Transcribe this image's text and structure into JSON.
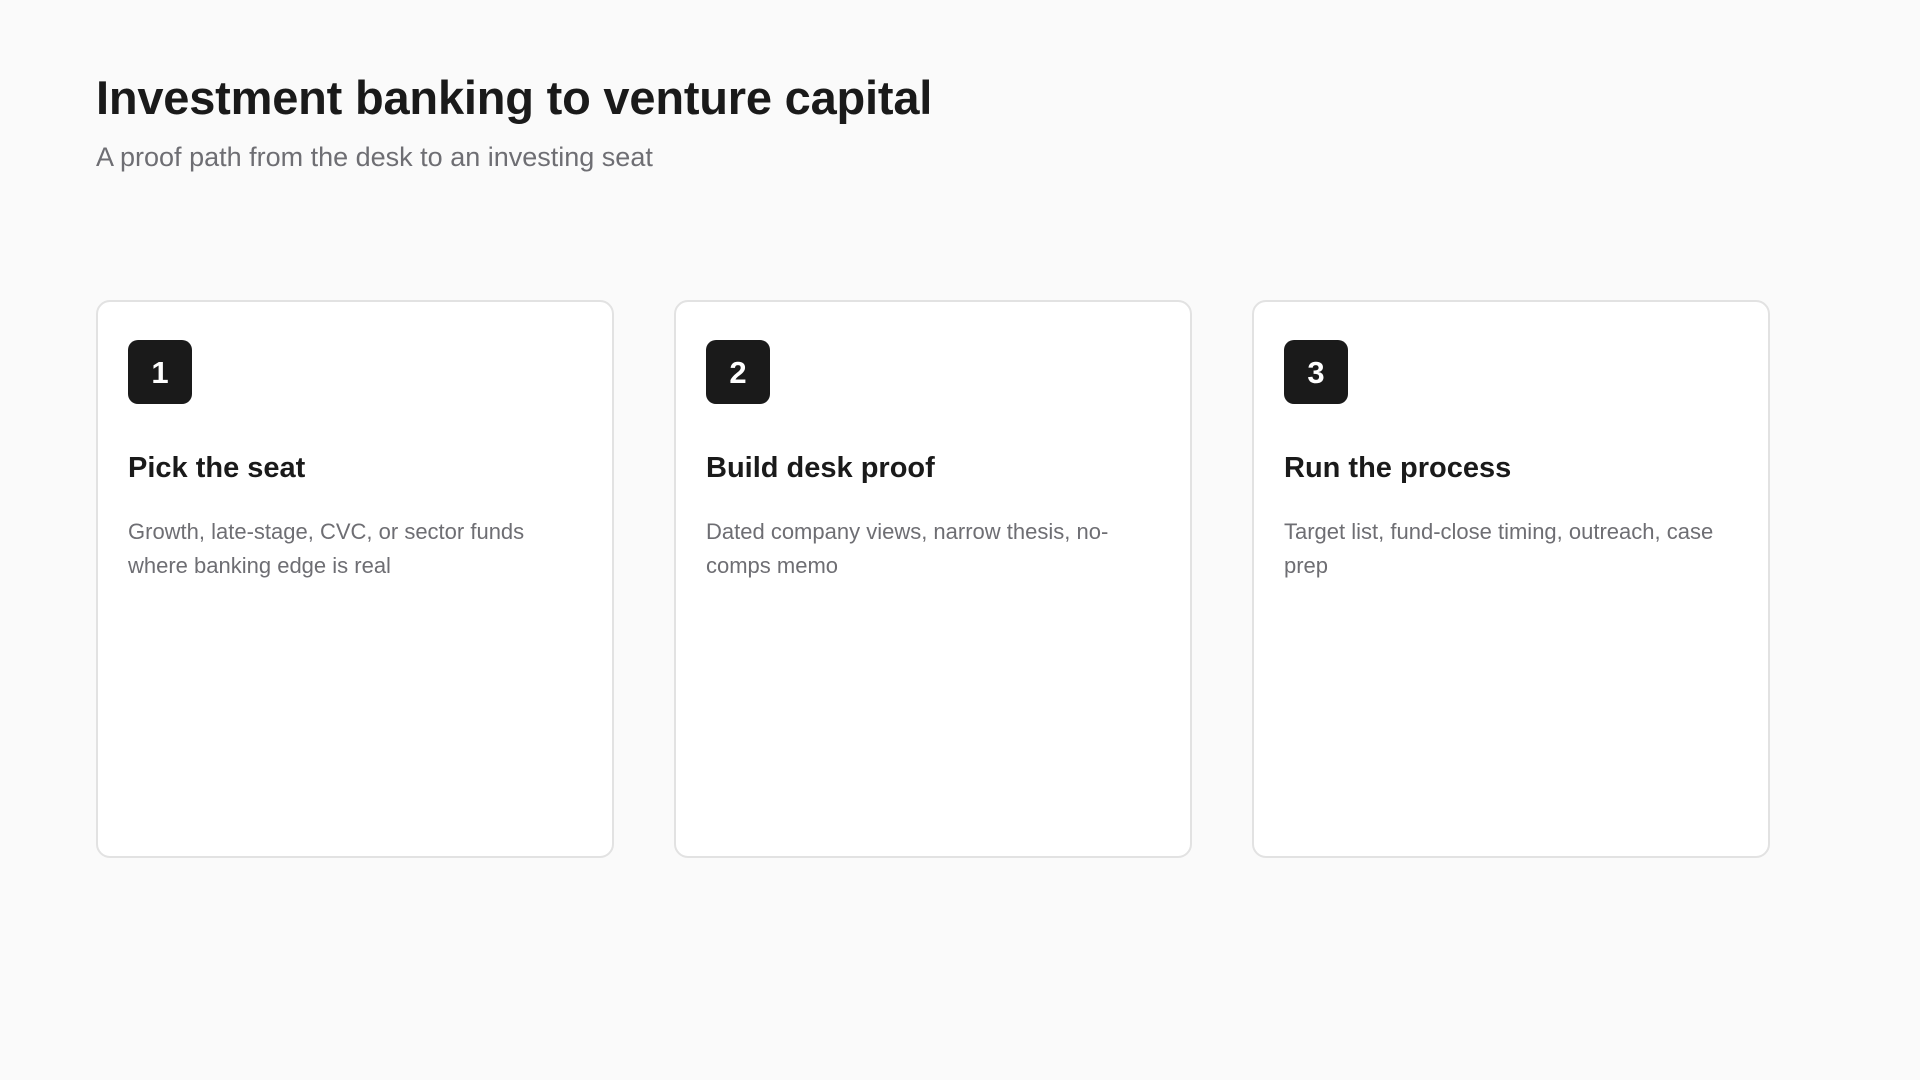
{
  "header": {
    "title": "Investment banking to venture capital",
    "subtitle": "A proof path from the desk to an investing seat"
  },
  "steps": [
    {
      "number": "1",
      "title": "Pick the seat",
      "description": "Growth, late-stage, CVC, or sector funds where banking edge is real"
    },
    {
      "number": "2",
      "title": "Build desk proof",
      "description": "Dated company views, narrow thesis, no-comps memo"
    },
    {
      "number": "3",
      "title": "Run the process",
      "description": "Target list, fund-close timing, outreach, case prep"
    }
  ]
}
